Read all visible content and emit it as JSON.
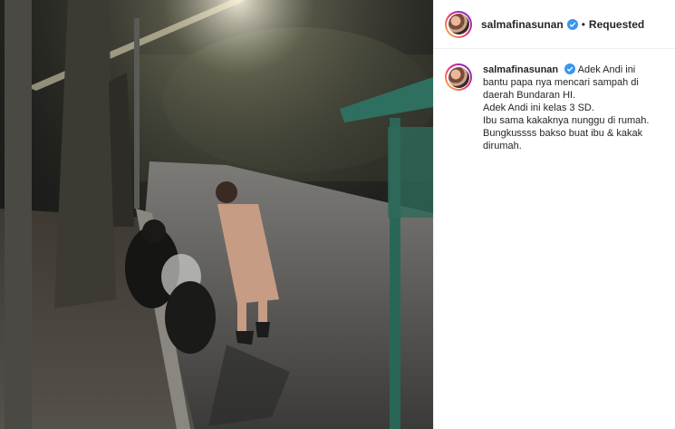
{
  "post": {
    "username": "salmafinasunan",
    "follow_status": "Requested",
    "separator": "•",
    "verified_icon": "verified-badge-icon",
    "caption_lines": [
      "Adek Andi ini",
      "bantu papa nya mencari sampah di",
      "daerah Bundaran HI.",
      "Adek Andi ini kelas 3 SD.",
      "Ibu sama kakaknya nunggu di rumah.",
      "Bungkussss bakso buat ibu & kakak",
      "dirumah."
    ]
  },
  "colors": {
    "verified_blue": "#3897f0",
    "text": "#262626",
    "divider": "#efefef"
  }
}
